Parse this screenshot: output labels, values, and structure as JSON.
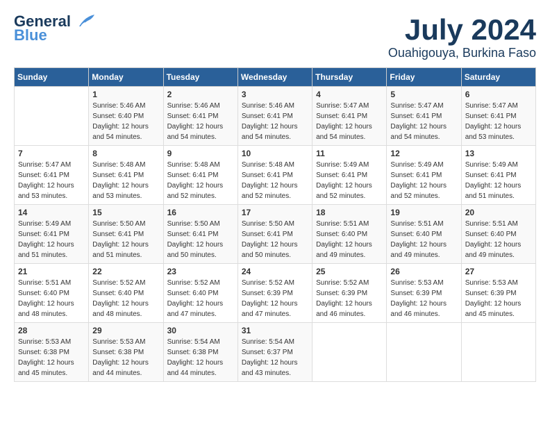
{
  "logo": {
    "line1": "General",
    "line2": "Blue"
  },
  "title": "July 2024",
  "location": "Ouahigouya, Burkina Faso",
  "headers": [
    "Sunday",
    "Monday",
    "Tuesday",
    "Wednesday",
    "Thursday",
    "Friday",
    "Saturday"
  ],
  "weeks": [
    [
      {
        "day": "",
        "info": ""
      },
      {
        "day": "1",
        "info": "Sunrise: 5:46 AM\nSunset: 6:40 PM\nDaylight: 12 hours\nand 54 minutes."
      },
      {
        "day": "2",
        "info": "Sunrise: 5:46 AM\nSunset: 6:41 PM\nDaylight: 12 hours\nand 54 minutes."
      },
      {
        "day": "3",
        "info": "Sunrise: 5:46 AM\nSunset: 6:41 PM\nDaylight: 12 hours\nand 54 minutes."
      },
      {
        "day": "4",
        "info": "Sunrise: 5:47 AM\nSunset: 6:41 PM\nDaylight: 12 hours\nand 54 minutes."
      },
      {
        "day": "5",
        "info": "Sunrise: 5:47 AM\nSunset: 6:41 PM\nDaylight: 12 hours\nand 54 minutes."
      },
      {
        "day": "6",
        "info": "Sunrise: 5:47 AM\nSunset: 6:41 PM\nDaylight: 12 hours\nand 53 minutes."
      }
    ],
    [
      {
        "day": "7",
        "info": "Sunrise: 5:47 AM\nSunset: 6:41 PM\nDaylight: 12 hours\nand 53 minutes."
      },
      {
        "day": "8",
        "info": "Sunrise: 5:48 AM\nSunset: 6:41 PM\nDaylight: 12 hours\nand 53 minutes."
      },
      {
        "day": "9",
        "info": "Sunrise: 5:48 AM\nSunset: 6:41 PM\nDaylight: 12 hours\nand 52 minutes."
      },
      {
        "day": "10",
        "info": "Sunrise: 5:48 AM\nSunset: 6:41 PM\nDaylight: 12 hours\nand 52 minutes."
      },
      {
        "day": "11",
        "info": "Sunrise: 5:49 AM\nSunset: 6:41 PM\nDaylight: 12 hours\nand 52 minutes."
      },
      {
        "day": "12",
        "info": "Sunrise: 5:49 AM\nSunset: 6:41 PM\nDaylight: 12 hours\nand 52 minutes."
      },
      {
        "day": "13",
        "info": "Sunrise: 5:49 AM\nSunset: 6:41 PM\nDaylight: 12 hours\nand 51 minutes."
      }
    ],
    [
      {
        "day": "14",
        "info": "Sunrise: 5:49 AM\nSunset: 6:41 PM\nDaylight: 12 hours\nand 51 minutes."
      },
      {
        "day": "15",
        "info": "Sunrise: 5:50 AM\nSunset: 6:41 PM\nDaylight: 12 hours\nand 51 minutes."
      },
      {
        "day": "16",
        "info": "Sunrise: 5:50 AM\nSunset: 6:41 PM\nDaylight: 12 hours\nand 50 minutes."
      },
      {
        "day": "17",
        "info": "Sunrise: 5:50 AM\nSunset: 6:41 PM\nDaylight: 12 hours\nand 50 minutes."
      },
      {
        "day": "18",
        "info": "Sunrise: 5:51 AM\nSunset: 6:40 PM\nDaylight: 12 hours\nand 49 minutes."
      },
      {
        "day": "19",
        "info": "Sunrise: 5:51 AM\nSunset: 6:40 PM\nDaylight: 12 hours\nand 49 minutes."
      },
      {
        "day": "20",
        "info": "Sunrise: 5:51 AM\nSunset: 6:40 PM\nDaylight: 12 hours\nand 49 minutes."
      }
    ],
    [
      {
        "day": "21",
        "info": "Sunrise: 5:51 AM\nSunset: 6:40 PM\nDaylight: 12 hours\nand 48 minutes."
      },
      {
        "day": "22",
        "info": "Sunrise: 5:52 AM\nSunset: 6:40 PM\nDaylight: 12 hours\nand 48 minutes."
      },
      {
        "day": "23",
        "info": "Sunrise: 5:52 AM\nSunset: 6:40 PM\nDaylight: 12 hours\nand 47 minutes."
      },
      {
        "day": "24",
        "info": "Sunrise: 5:52 AM\nSunset: 6:39 PM\nDaylight: 12 hours\nand 47 minutes."
      },
      {
        "day": "25",
        "info": "Sunrise: 5:52 AM\nSunset: 6:39 PM\nDaylight: 12 hours\nand 46 minutes."
      },
      {
        "day": "26",
        "info": "Sunrise: 5:53 AM\nSunset: 6:39 PM\nDaylight: 12 hours\nand 46 minutes."
      },
      {
        "day": "27",
        "info": "Sunrise: 5:53 AM\nSunset: 6:39 PM\nDaylight: 12 hours\nand 45 minutes."
      }
    ],
    [
      {
        "day": "28",
        "info": "Sunrise: 5:53 AM\nSunset: 6:38 PM\nDaylight: 12 hours\nand 45 minutes."
      },
      {
        "day": "29",
        "info": "Sunrise: 5:53 AM\nSunset: 6:38 PM\nDaylight: 12 hours\nand 44 minutes."
      },
      {
        "day": "30",
        "info": "Sunrise: 5:54 AM\nSunset: 6:38 PM\nDaylight: 12 hours\nand 44 minutes."
      },
      {
        "day": "31",
        "info": "Sunrise: 5:54 AM\nSunset: 6:37 PM\nDaylight: 12 hours\nand 43 minutes."
      },
      {
        "day": "",
        "info": ""
      },
      {
        "day": "",
        "info": ""
      },
      {
        "day": "",
        "info": ""
      }
    ]
  ]
}
